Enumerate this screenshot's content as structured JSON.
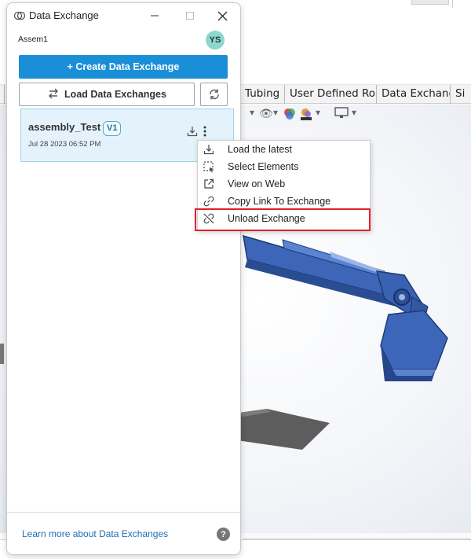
{
  "panel": {
    "title": "Data Exchange",
    "assembly": "Assem1",
    "user_initials": "YS",
    "create_button": "+ Create Data Exchange",
    "load_button": "Load Data Exchanges",
    "learn_more": "Learn more about Data Exchanges",
    "help": "?"
  },
  "exchange": {
    "name": "assembly_Test",
    "version": "V1",
    "date": "Jul 28 2023 06:52 PM"
  },
  "context_menu": {
    "items": [
      {
        "label": "Load the latest",
        "icon": "download-icon"
      },
      {
        "label": "Select Elements",
        "icon": "select-elements-icon"
      },
      {
        "label": "View on Web",
        "icon": "external-link-icon"
      },
      {
        "label": "Copy Link To Exchange",
        "icon": "link-icon"
      },
      {
        "label": "Unload Exchange",
        "icon": "unlink-icon"
      }
    ],
    "highlighted_item": "Unload Exchange"
  },
  "cad_tabs": [
    "Tubing",
    "User Defined Route",
    "Data Exchange",
    "Si"
  ],
  "colors": {
    "accent": "#1a8fd8",
    "card_background": "#e4f3fb",
    "highlight_border": "#e0202a",
    "link": "#1e6fb5"
  }
}
